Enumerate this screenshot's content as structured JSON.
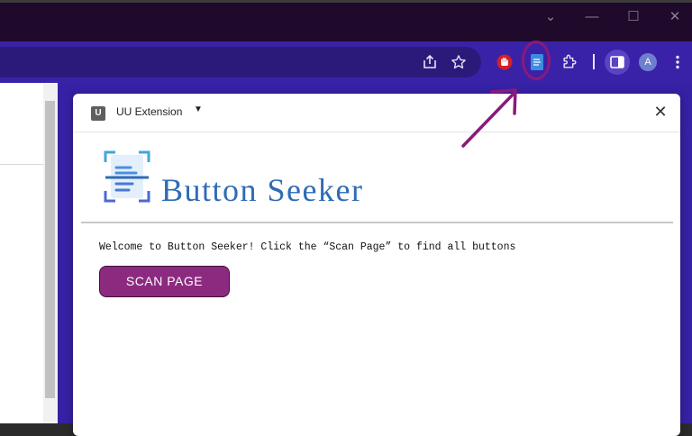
{
  "titlebar": {
    "controls": {
      "dropdown": "⌄",
      "minimize": "—",
      "maximize": "☐",
      "close": "✕"
    }
  },
  "toolbar": {
    "profile_initial": "A",
    "icons": [
      "share-icon",
      "star-icon",
      "red-hand-extension-icon",
      "button-seeker-extension-icon",
      "puzzle-extensions-icon",
      "side-panel-icon",
      "profile-avatar",
      "more-menu-icon"
    ]
  },
  "popup": {
    "extension_badge": "U",
    "extension_name": "UU Extension",
    "caret": "▼",
    "close": "✕",
    "app_title": "Button Seeker",
    "welcome_text": "Welcome to Button Seeker! Click the “Scan Page” to find all buttons",
    "scan_button": "SCAN PAGE"
  },
  "colors": {
    "titlebar": "#1f0a2c",
    "toolbar": "#3a22a8",
    "popup_bg": "#ffffff",
    "title_blue": "#2f6bb6",
    "scan_button": "#8c2a80",
    "annotation": "#8a1a7a"
  }
}
